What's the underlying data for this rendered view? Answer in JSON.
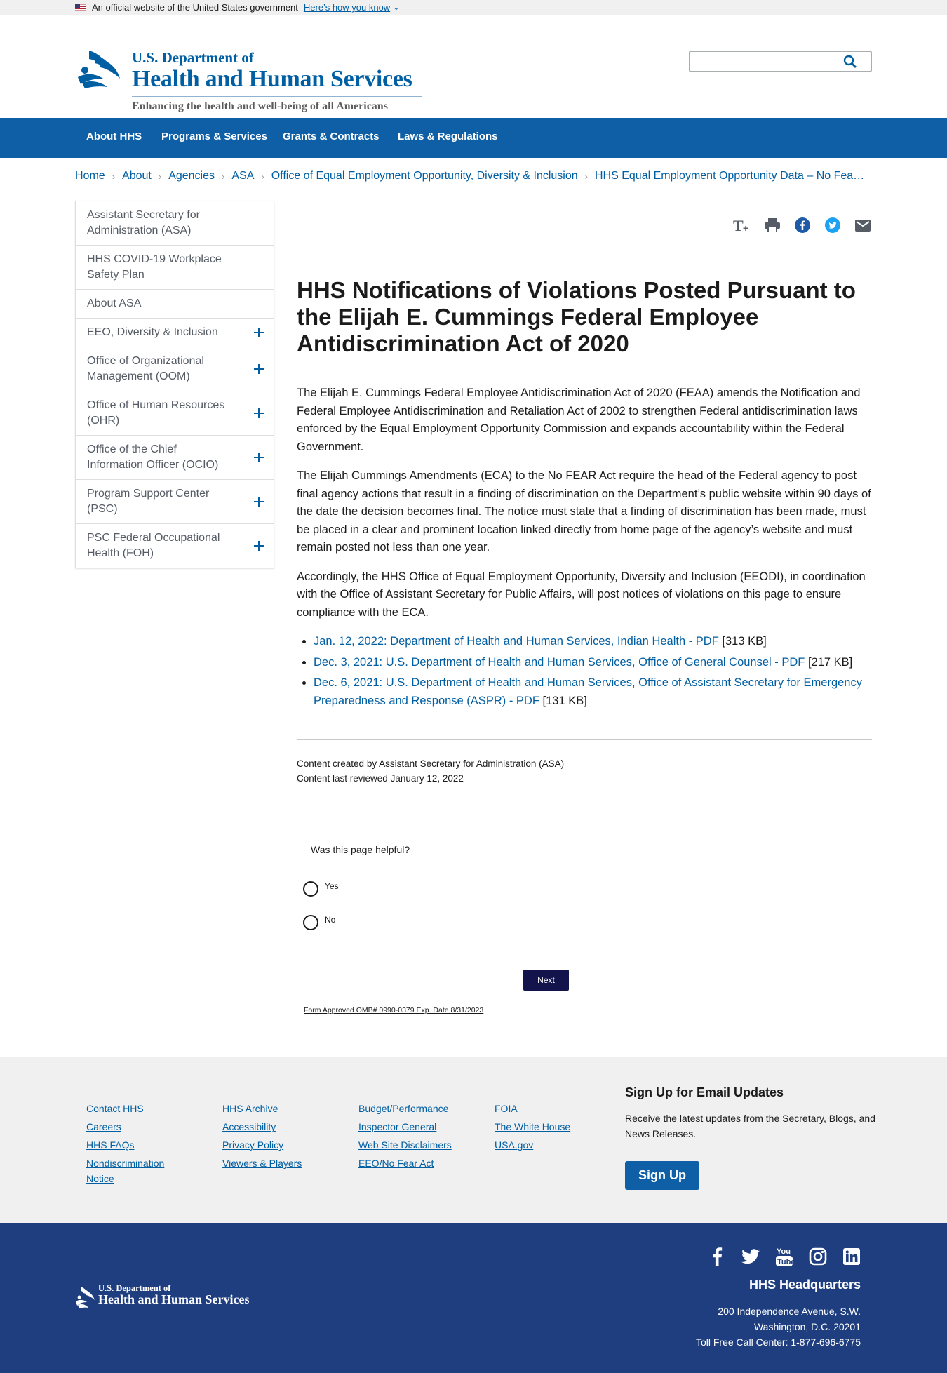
{
  "gov_banner": {
    "text": "An official website of the United States government",
    "how_link": "Here’s how you know"
  },
  "logo": {
    "line1": "U.S. Department of",
    "line2": "Health and Human Services",
    "tagline": "Enhancing the health and well-being of all Americans"
  },
  "search": {
    "value": "",
    "placeholder": ""
  },
  "nav": {
    "items": [
      "About HHS",
      "Programs & Services",
      "Grants & Contracts",
      "Laws & Regulations"
    ]
  },
  "breadcrumb": {
    "items": [
      "Home",
      "About",
      "Agencies",
      "ASA",
      "Office of Equal Employment Opportunity, Diversity & Inclusion"
    ],
    "current": "HHS Equal Employment Opportunity Data – No Fea…"
  },
  "sidebar": {
    "items": [
      {
        "label": "Assistant Secretary for Administration (ASA)",
        "expandable": false
      },
      {
        "label": "HHS COVID-19 Workplace Safety Plan",
        "expandable": false
      },
      {
        "label": "About ASA",
        "expandable": false
      },
      {
        "label": "EEO, Diversity & Inclusion",
        "expandable": true
      },
      {
        "label": "Office of Organizational Management (OOM)",
        "expandable": true
      },
      {
        "label": "Office of Human Resources (OHR)",
        "expandable": true
      },
      {
        "label": "Office of the Chief Information Officer (OCIO)",
        "expandable": true
      },
      {
        "label": "Program Support Center (PSC)",
        "expandable": true
      },
      {
        "label": "PSC Federal Occupational Health (FOH)",
        "expandable": true
      }
    ]
  },
  "tools": [
    "text-size-icon",
    "print-icon",
    "facebook-icon",
    "twitter-icon",
    "email-icon"
  ],
  "main": {
    "title": "HHS Notifications of Violations Posted Pursuant to the Elijah E. Cummings Federal Employee Antidiscrimination Act of 2020",
    "paragraphs": [
      "The Elijah E. Cummings Federal Employee Antidiscrimination Act of 2020 (FEAA) amends the Notification and Federal Employee Antidiscrimination and Retaliation Act of 2002 to strengthen Federal antidiscrimination laws enforced by the Equal Employment Opportunity Commission and expands accountability within the Federal Government.",
      "The Elijah Cummings Amendments (ECA) to the No FEAR Act require the head of the Federal agency to post final agency actions that result  in a finding of discrimination on the Department’s public website within 90 days of the date the decision becomes final.  The notice must state that a finding of discrimination has been made, must be placed in a clear and prominent location linked directly from home page of the agency’s website and must remain posted not less than one year.",
      "Accordingly, the HHS Office of Equal Employment Opportunity, Diversity and Inclusion (EEODI), in coordination with the Office of Assistant Secretary for Public Affairs, will post notices of violations on this page to ensure compliance with the ECA."
    ],
    "links": [
      {
        "text": "Jan. 12, 2022: Department of Health and Human Services, Indian Health - PDF",
        "size": " [313 KB]"
      },
      {
        "text": "Dec. 3, 2021: U.S. Department of Health and Human Services, Office of General Counsel - PDF",
        "size": " [217 KB]"
      },
      {
        "text": "Dec. 6, 2021: U.S. Department of Health and Human Services, Office of Assistant Secretary for Emergency Preparedness and Response (ASPR) - PDF",
        "size": " [131 KB]"
      }
    ],
    "created_by": "Content created by Assistant Secretary for Administration (ASA)",
    "reviewed": "Content last reviewed January 12, 2022"
  },
  "feedback": {
    "question": "Was this page helpful?",
    "options": [
      "Yes",
      "No"
    ],
    "next": "Next",
    "omb": "Form Approved OMB# 0990-0379 Exp. Date 8/31/2023"
  },
  "footer": {
    "columns": [
      [
        "Contact HHS",
        "Careers",
        "HHS FAQs",
        "Nondiscrimination Notice"
      ],
      [
        "HHS Archive",
        "Accessibility",
        "Privacy Policy",
        "Viewers & Players"
      ],
      [
        "Budget/Performance",
        "Inspector General",
        "Web Site Disclaimers",
        "EEO/No Fear Act"
      ],
      [
        "FOIA",
        "The White House",
        "USA.gov"
      ]
    ],
    "signup_title": "Sign Up for Email Updates",
    "signup_text": "Receive the latest updates from the Secretary, Blogs, and News Releases.",
    "signup_button": "Sign Up",
    "logo_line1": "U.S. Department of",
    "logo_line2": "Health and Human Services",
    "socials": [
      "facebook-icon",
      "twitter-icon",
      "youtube-icon",
      "instagram-icon",
      "linkedin-icon"
    ],
    "hq_title": "HHS Headquarters",
    "hq_lines": [
      "200 Independence Avenue, S.W.",
      "Washington, D.C. 20201",
      "Toll Free Call Center: 1-877-696-6775"
    ]
  },
  "colors": {
    "primary_blue": "#005ea2",
    "nav_blue": "#0e5fa6",
    "footer_navy": "#1f3e7f",
    "next_button": "#14144d"
  }
}
